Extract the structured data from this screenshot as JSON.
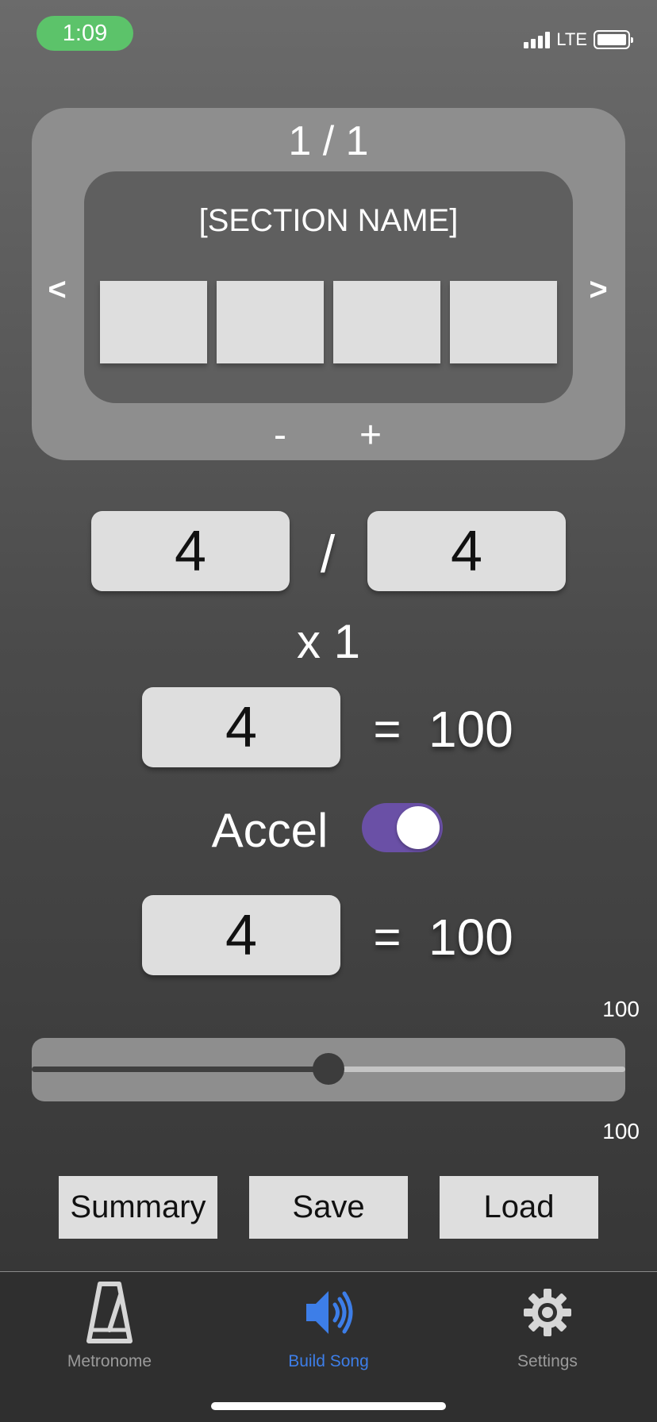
{
  "status_bar": {
    "time": "1:09",
    "network": "LTE"
  },
  "section": {
    "counter": "1 / 1",
    "name": "[SECTION NAME]",
    "prev_label": "<",
    "next_label": ">",
    "minus_label": "-",
    "plus_label": "+",
    "beat_boxes": [
      "",
      "",
      "",
      ""
    ]
  },
  "time_signature": {
    "numerator": "4",
    "separator": "/",
    "denominator": "4"
  },
  "repeat": "x 1",
  "tempo_start": {
    "note_value": "4",
    "equals": "=",
    "bpm": "100"
  },
  "accel": {
    "label": "Accel",
    "enabled": true,
    "accent_color": "#6a50a6"
  },
  "tempo_end": {
    "note_value": "4",
    "equals": "=",
    "bpm": "100"
  },
  "slider": {
    "top_value": "100",
    "bottom_value": "100",
    "position": 0.5
  },
  "actions": {
    "summary": "Summary",
    "save": "Save",
    "load": "Load"
  },
  "tab_bar": {
    "active_color": "#3d7ee8",
    "tabs": [
      {
        "label": "Metronome",
        "icon": "metronome-icon",
        "active": false
      },
      {
        "label": "Build Song",
        "icon": "speaker-icon",
        "active": true
      },
      {
        "label": "Settings",
        "icon": "gear-icon",
        "active": false
      }
    ]
  }
}
